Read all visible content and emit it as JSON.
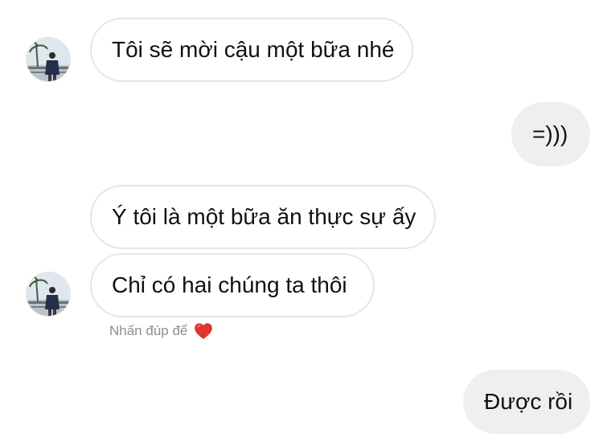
{
  "messages": [
    {
      "sender": "them",
      "text": "Tôi sẽ mời cậu một bữa nhé"
    },
    {
      "sender": "me",
      "text": "=)))"
    },
    {
      "sender": "them",
      "text": "Ý tôi là một bữa ăn thực sự ấy"
    },
    {
      "sender": "them",
      "text": "Chỉ có hai chúng ta thôi"
    },
    {
      "sender": "me",
      "text": "Được rồi"
    }
  ],
  "reaction_hint": {
    "text": "Nhấn đúp để",
    "icon": "heart-icon",
    "icon_color": "#e0342f"
  },
  "colors": {
    "incoming_bubble_bg": "#ffffff",
    "incoming_bubble_border": "#e6e6e6",
    "outgoing_bubble_bg": "#efefef",
    "hint_text": "#8e8e8e"
  }
}
